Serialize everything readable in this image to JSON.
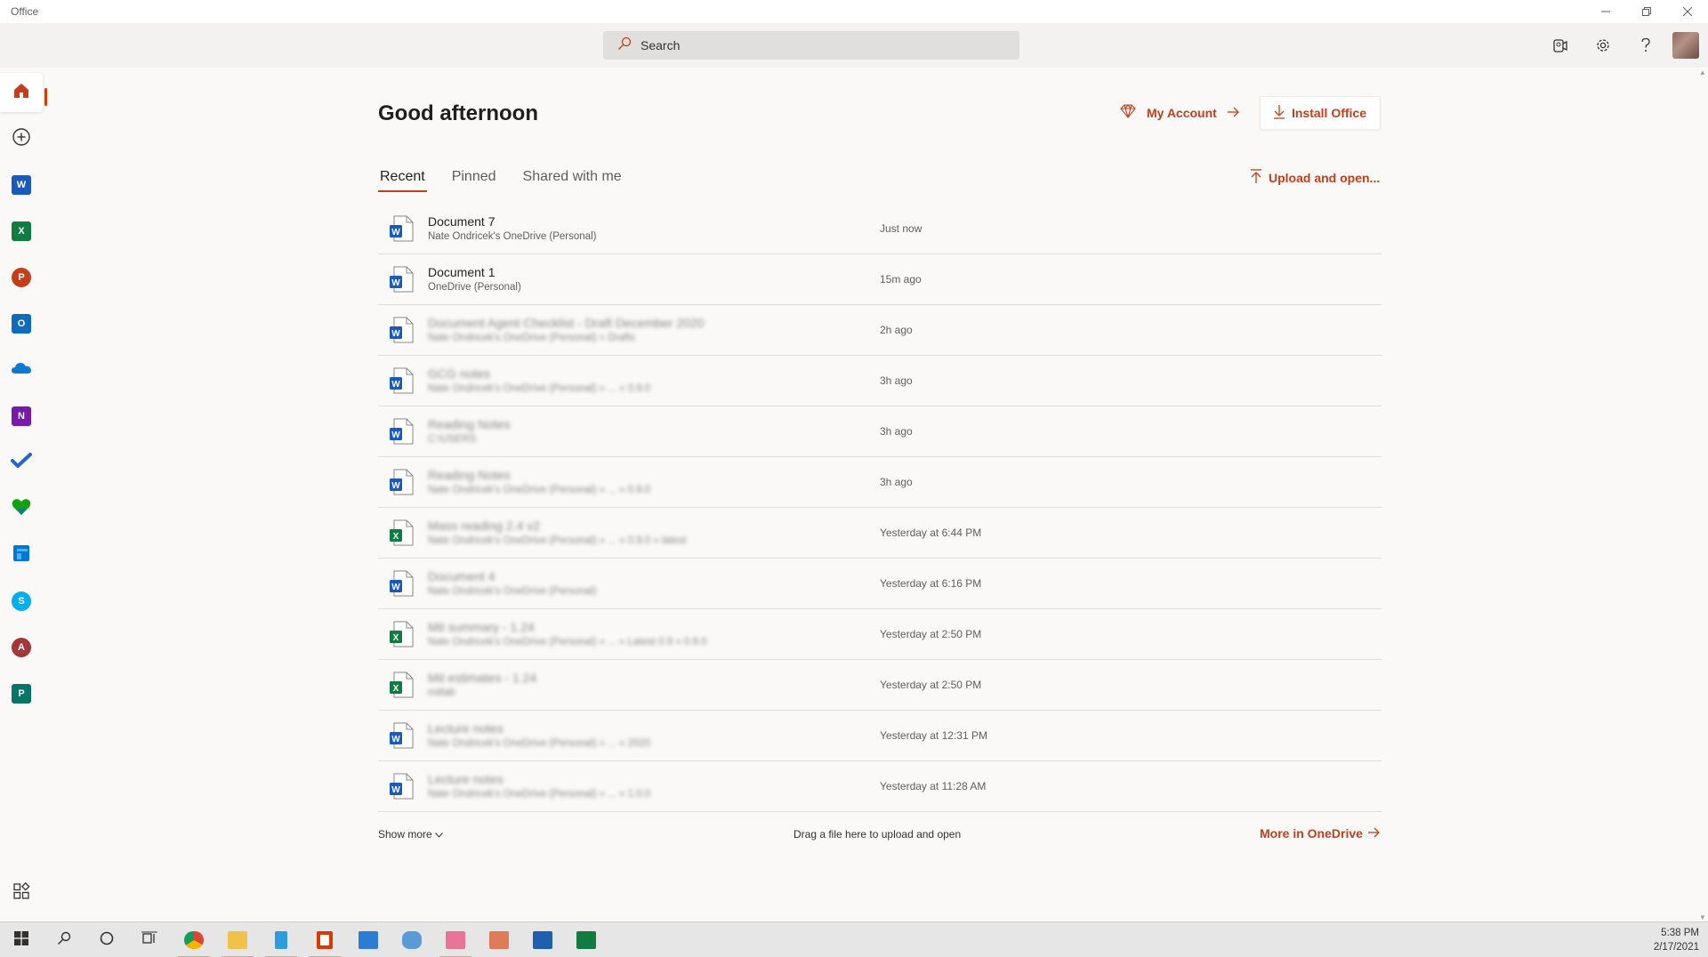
{
  "window": {
    "title": "Office"
  },
  "header": {
    "search_label": "Search",
    "icons": [
      "meet-now-icon",
      "settings-gear-icon",
      "help-icon",
      "user-avatar"
    ]
  },
  "rail": {
    "items": [
      "home-icon",
      "create-new-icon",
      "word-app",
      "excel-app",
      "powerpoint-app",
      "outlook-app",
      "onedrive-app",
      "onenote-app",
      "todo-app",
      "family-safety-app",
      "teams-app",
      "skype-app",
      "access-app",
      "publisher-app",
      "all-apps-icon"
    ]
  },
  "main": {
    "greeting": "Good afternoon",
    "my_account": "My Account",
    "install_office": "Install Office",
    "tabs": [
      {
        "label": "Recent"
      },
      {
        "label": "Pinned"
      },
      {
        "label": "Shared with me"
      }
    ],
    "upload_open": "Upload and open...",
    "files": [
      {
        "type": "word",
        "name": "Document 7",
        "location": "Nate Ondricek's OneDrive (Personal)",
        "time": "Just now"
      },
      {
        "type": "word",
        "name": "Document 1",
        "location": "OneDrive (Personal)",
        "time": "15m ago"
      },
      {
        "type": "word",
        "name": "Document Agent Checklist - Draft December 2020",
        "location": "Nate Ondricek's OneDrive (Personal) » Drafts",
        "time": "2h ago"
      },
      {
        "type": "word",
        "name": "GCG notes",
        "location": "Nate Ondricek's OneDrive (Personal) » ... » 0.9.0",
        "time": "3h ago"
      },
      {
        "type": "word",
        "name": "Reading Notes",
        "location": "C:\\USERS",
        "time": "3h ago"
      },
      {
        "type": "word",
        "name": "Reading Notes",
        "location": "Nate Ondricek's OneDrive (Personal) » ... » 0.9.0",
        "time": "3h ago"
      },
      {
        "type": "excel",
        "name": "Mass reading 2.4 v2",
        "location": "Nate Ondricek's OneDrive (Personal) » ... » 0.9.0 » latest",
        "time": "Yesterday at 6:44 PM"
      },
      {
        "type": "word",
        "name": "Document 4",
        "location": "Nate Ondricek's OneDrive (Personal)",
        "time": "Yesterday at 6:16 PM"
      },
      {
        "type": "excel",
        "name": "Mit summary - 1.24",
        "location": "Nate Ondricek's OneDrive (Personal) » ... » Latest 0.9 » 0.9.0",
        "time": "Yesterday at 2:50 PM"
      },
      {
        "type": "excel",
        "name": "Mit estimates - 1.24",
        "location": "mitlab",
        "time": "Yesterday at 2:50 PM"
      },
      {
        "type": "word",
        "name": "Lecture notes",
        "location": "Nate Ondricek's OneDrive (Personal) » ... » 2020",
        "time": "Yesterday at 12:31 PM"
      },
      {
        "type": "word",
        "name": "Lecture notes",
        "location": "Nate Ondricek's OneDrive (Personal) » ... » 1.0.0",
        "time": "Yesterday at 11:28 AM"
      }
    ],
    "show_more": "Show more",
    "drag_text": "Drag a file here to upload and open",
    "more_onedrive": "More in OneDrive"
  },
  "taskbar": {
    "time": "5:38 PM",
    "date": "2/17/2021"
  },
  "colors": {
    "accent": "#c43e1c",
    "word": "#185abd",
    "excel": "#107c41",
    "powerpoint": "#c43e1c"
  }
}
